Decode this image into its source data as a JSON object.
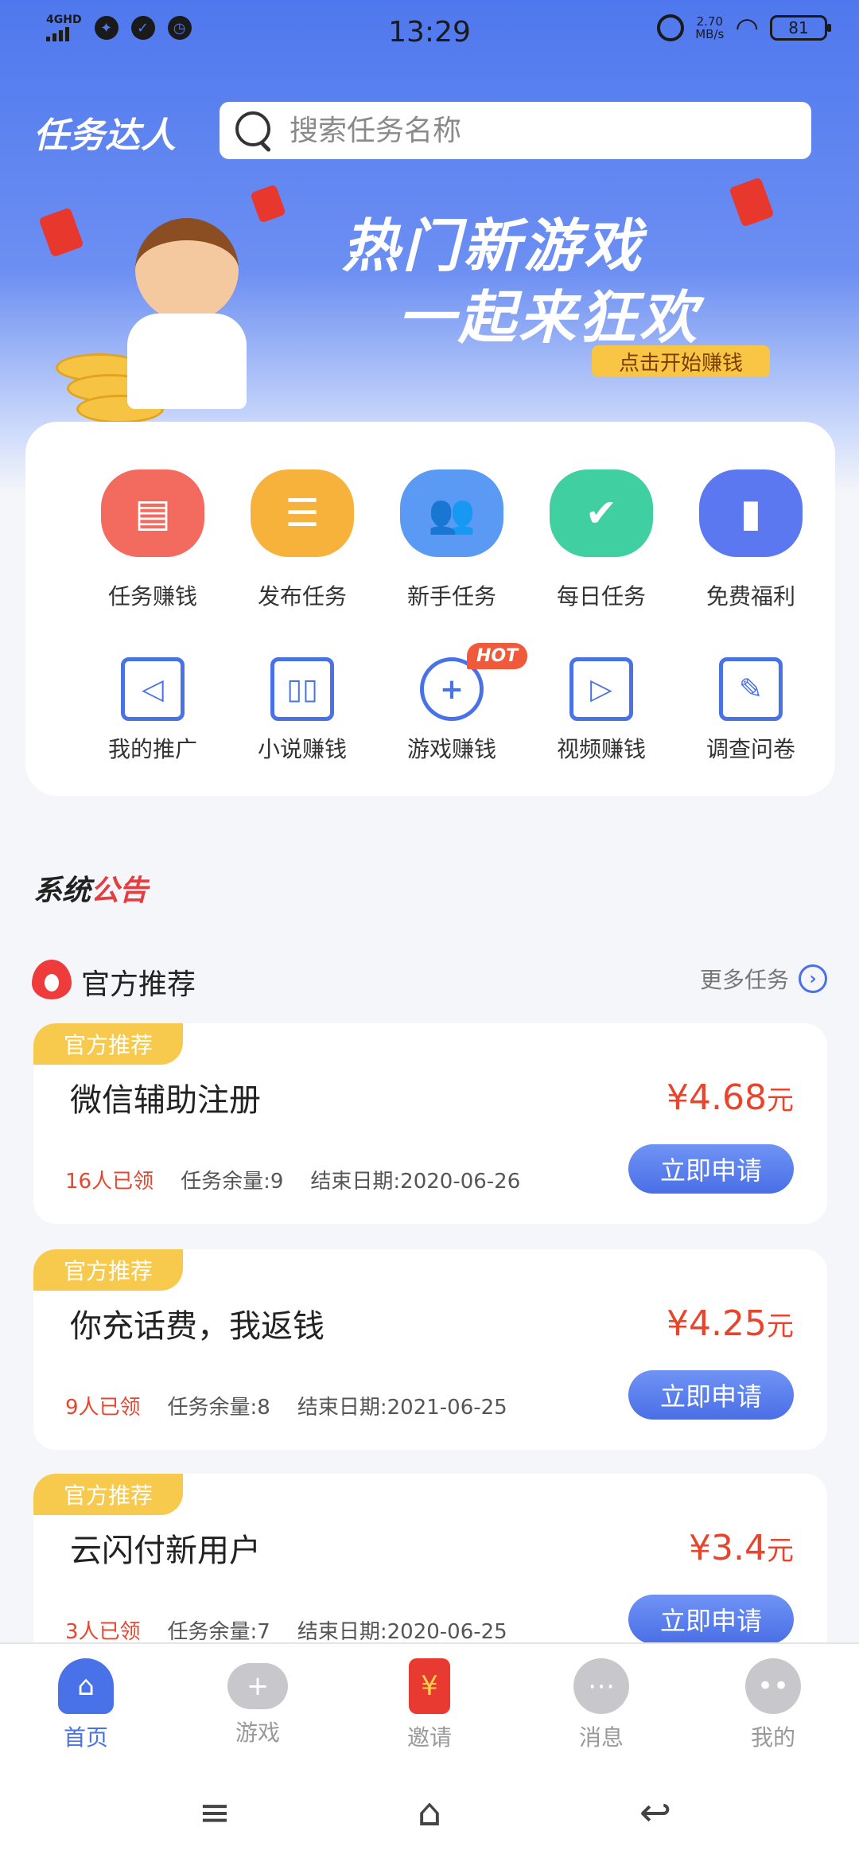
{
  "status_bar": {
    "network": "4GHD",
    "time": "13:29",
    "speed": "2.70",
    "speed_unit": "MB/s",
    "battery": "81"
  },
  "header": {
    "logo": "任务达人",
    "search_placeholder": "搜索任务名称"
  },
  "banner": {
    "title_line1": "热门新游戏",
    "title_line2": "一起来狂欢",
    "cta": "点击开始赚钱"
  },
  "grid": {
    "row1": [
      {
        "label": "任务赚钱",
        "icon": "store-icon",
        "color": "#f36a5e"
      },
      {
        "label": "发布任务",
        "icon": "document-icon",
        "color": "#f7b23b"
      },
      {
        "label": "新手任务",
        "icon": "users-icon",
        "color": "#5a9af5"
      },
      {
        "label": "每日任务",
        "icon": "calendar-check-icon",
        "color": "#3fcfa0"
      },
      {
        "label": "免费福利",
        "icon": "bookmark-icon",
        "color": "#5b78f0"
      }
    ],
    "row2": [
      {
        "label": "我的推广",
        "icon": "speaker-icon"
      },
      {
        "label": "小说赚钱",
        "icon": "book-icon"
      },
      {
        "label": "游戏赚钱",
        "icon": "gamepad-icon",
        "badge": "HOT"
      },
      {
        "label": "视频赚钱",
        "icon": "video-icon"
      },
      {
        "label": "调查问卷",
        "icon": "survey-icon"
      }
    ]
  },
  "notice": {
    "part1": "系统",
    "part2": "公告"
  },
  "section": {
    "title": "官方推荐",
    "more": "更多任务"
  },
  "tasks": [
    {
      "tag": "官方推荐",
      "name": "微信辅助注册",
      "price": "¥4.68",
      "unit": "元",
      "taken": "16人已领",
      "remaining": "任务余量:9",
      "end": "结束日期:2020-06-26",
      "button": "立即申请"
    },
    {
      "tag": "官方推荐",
      "name": "你充话费，我返钱",
      "price": "¥4.25",
      "unit": "元",
      "taken": "9人已领",
      "remaining": "任务余量:8",
      "end": "结束日期:2021-06-25",
      "button": "立即申请"
    },
    {
      "tag": "官方推荐",
      "name": "云闪付新用户",
      "price": "¥3.4",
      "unit": "元",
      "taken": "3人已领",
      "remaining": "任务余量:7",
      "end": "结束日期:2020-06-25",
      "button": "立即申请"
    }
  ],
  "tabs": [
    {
      "label": "首页",
      "icon": "home-icon"
    },
    {
      "label": "游戏",
      "icon": "gamepad-icon"
    },
    {
      "label": "邀请",
      "icon": "red-envelope-icon",
      "glyph": "¥"
    },
    {
      "label": "消息",
      "icon": "chat-icon"
    },
    {
      "label": "我的",
      "icon": "profile-icon"
    }
  ],
  "colors": {
    "accent": "#4a72e8",
    "price": "#e8452c",
    "tag": "#f7c94d"
  }
}
